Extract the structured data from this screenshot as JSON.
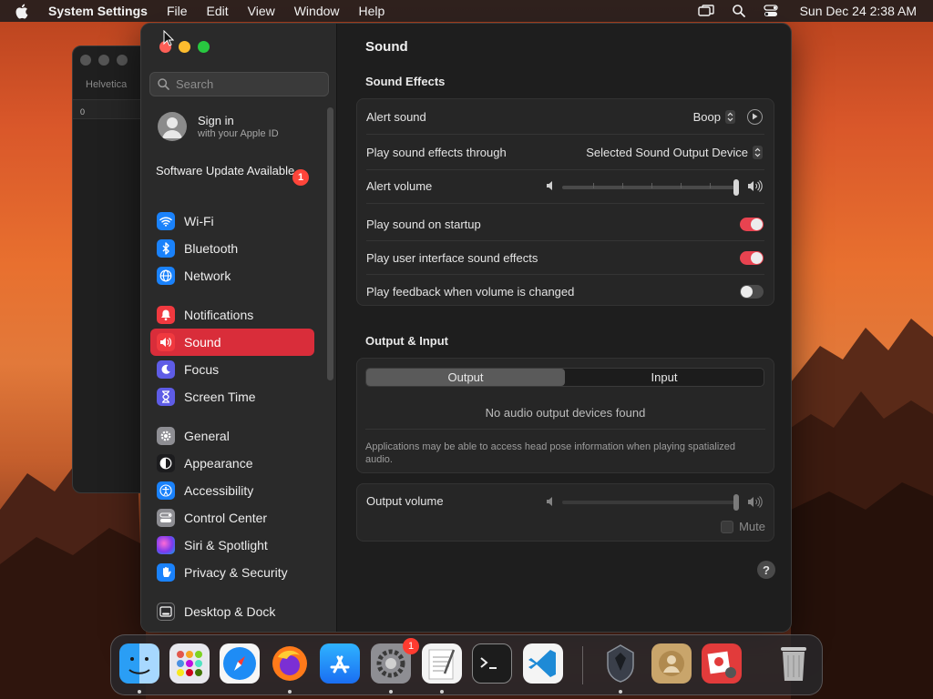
{
  "menubar": {
    "app_name": "System Settings",
    "menus": [
      "File",
      "Edit",
      "View",
      "Window",
      "Help"
    ],
    "clock": "Sun Dec 24  2:38 AM"
  },
  "background_window": {
    "font_name": "Helvetica",
    "ruler_zero": "0"
  },
  "sidebar": {
    "search_placeholder": "Search",
    "account": {
      "title": "Sign in",
      "subtitle": "with your Apple ID"
    },
    "software_update": {
      "label": "Software Update Available",
      "badge": "1"
    },
    "items": [
      {
        "label": "Wi-Fi",
        "icon": "wifi-icon",
        "color": "#1a82fb"
      },
      {
        "label": "Bluetooth",
        "icon": "bluetooth-icon",
        "color": "#1a82fb"
      },
      {
        "label": "Network",
        "icon": "globe-icon",
        "color": "#1a82fb"
      },
      {
        "label": "Notifications",
        "icon": "bell-icon",
        "color": "#f0393f"
      },
      {
        "label": "Sound",
        "icon": "speaker-icon",
        "color": "#f0393f",
        "selected": true
      },
      {
        "label": "Focus",
        "icon": "moon-icon",
        "color": "#5e5ce6"
      },
      {
        "label": "Screen Time",
        "icon": "hourglass-icon",
        "color": "#5e5ce6"
      },
      {
        "label": "General",
        "icon": "gear-icon",
        "color": "#8e8e93"
      },
      {
        "label": "Appearance",
        "icon": "appearance-icon",
        "color": "#1c1c1e"
      },
      {
        "label": "Accessibility",
        "icon": "accessibility-icon",
        "color": "#1a82fb"
      },
      {
        "label": "Control Center",
        "icon": "control-center-icon",
        "color": "#8e8e93"
      },
      {
        "label": "Siri & Spotlight",
        "icon": "siri-icon",
        "color": "#b54ad8"
      },
      {
        "label": "Privacy & Security",
        "icon": "hand-icon",
        "color": "#1a82fb"
      },
      {
        "label": "Desktop & Dock",
        "icon": "dock-icon",
        "color": "#2c2c2e"
      }
    ]
  },
  "content": {
    "title": "Sound",
    "sound_effects": {
      "heading": "Sound Effects",
      "alert_sound": {
        "label": "Alert sound",
        "value": "Boop"
      },
      "output_through": {
        "label": "Play sound effects through",
        "value": "Selected Sound Output Device"
      },
      "alert_volume": {
        "label": "Alert volume",
        "level": 1.0
      },
      "startup": {
        "label": "Play sound on startup",
        "on": true
      },
      "ui_effects": {
        "label": "Play user interface sound effects",
        "on": true
      },
      "feedback": {
        "label": "Play feedback when volume is changed",
        "on": false
      }
    },
    "output_input": {
      "heading": "Output & Input",
      "tabs": [
        "Output",
        "Input"
      ],
      "active_tab": "Output",
      "empty_message": "No audio output devices found",
      "note": "Applications may be able to access head pose information when playing spatialized audio."
    },
    "output_volume": {
      "label": "Output volume",
      "level": 1.0,
      "mute_label": "Mute"
    },
    "help": "?"
  },
  "dock": {
    "apps": [
      "finder",
      "launchpad",
      "safari",
      "firefox",
      "app-store",
      "system-settings",
      "textedit",
      "terminal",
      "vscode",
      "security-app",
      "contacts",
      "photo-booth",
      "trash"
    ],
    "system_settings_badge": "1"
  },
  "colors": {
    "accent": "#d92d3a",
    "toggle_on": "#e84350"
  }
}
